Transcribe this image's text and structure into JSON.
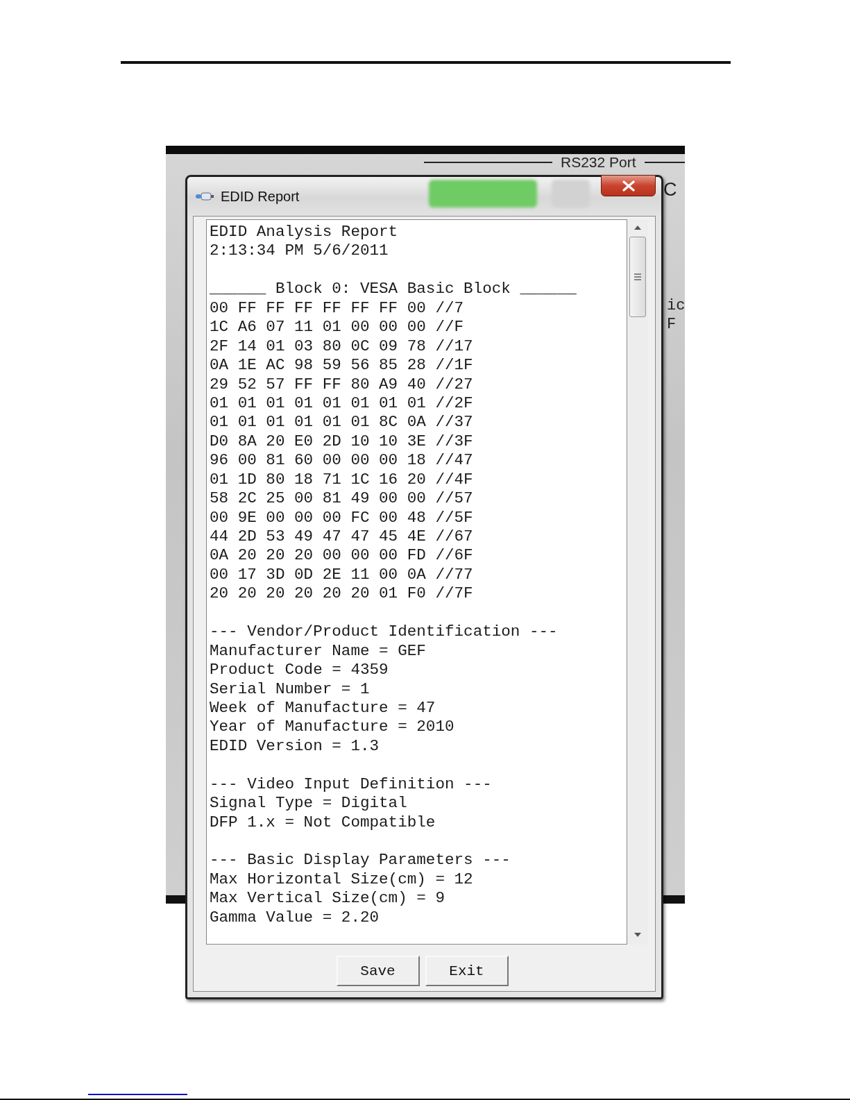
{
  "background_window": {
    "group_label": "RS232 Port",
    "cut_texts": [
      "C",
      "ic",
      "F"
    ]
  },
  "dialog": {
    "title": "EDID Report",
    "report": [
      {
        "lines": [
          "EDID Analysis Report",
          "2:13:34 PM 5/6/2011"
        ]
      },
      {
        "lines": [
          "______ Block 0: VESA Basic Block ______",
          "00 FF FF FF FF FF FF 00 //7",
          "1C A6 07 11 01 00 00 00 //F",
          "2F 14 01 03 80 0C 09 78 //17",
          "0A 1E AC 98 59 56 85 28 //1F",
          "29 52 57 FF FF 80 A9 40 //27",
          "01 01 01 01 01 01 01 01 //2F",
          "01 01 01 01 01 01 8C 0A //37",
          "D0 8A 20 E0 2D 10 10 3E //3F",
          "96 00 81 60 00 00 00 18 //47",
          "01 1D 80 18 71 1C 16 20 //4F",
          "58 2C 25 00 81 49 00 00 //57",
          "00 9E 00 00 00 FC 00 48 //5F",
          "44 2D 53 49 47 47 45 4E //67",
          "0A 20 20 20 00 00 00 FD //6F",
          "00 17 3D 0D 2E 11 00 0A //77",
          "20 20 20 20 20 20 01 F0 //7F"
        ]
      },
      {
        "lines": [
          "--- Vendor/Product Identification ---",
          "Manufacturer Name = GEF",
          "Product Code = 4359",
          "Serial Number = 1",
          "Week of Manufacture = 47",
          "Year of Manufacture = 2010",
          "EDID Version = 1.3"
        ]
      },
      {
        "lines": [
          "--- Video Input Definition ---",
          "Signal Type = Digital",
          "DFP 1.x = Not Compatible"
        ]
      },
      {
        "lines": [
          "--- Basic Display Parameters ---",
          "Max Horizontal Size(cm) = 12",
          "Max Vertical Size(cm) = 9",
          "Gamma Value = 2.20"
        ]
      }
    ],
    "buttons": [
      "Save",
      "Exit"
    ]
  }
}
